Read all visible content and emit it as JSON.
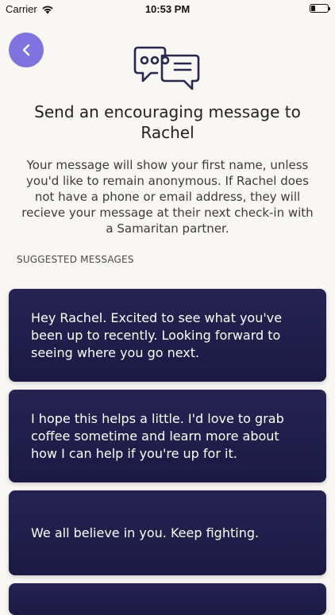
{
  "status_bar": {
    "carrier": "Carrier",
    "time": "10:53 PM",
    "battery_level_percent": 25
  },
  "header": {
    "back_icon": "chevron-left-icon",
    "back_button_color": "#8073df",
    "illustration_icon": "chat-bubbles-icon",
    "title": "Send an encouraging message to Rachel"
  },
  "description": "Your message will show your first name, unless you'd like to remain anonymous. If Rachel does not have a phone or email address, they will recieve your message at their next check-in with a Samaritan partner.",
  "suggested": {
    "label": "SUGGESTED MESSAGES",
    "card_color": "#221f4d",
    "messages": [
      "Hey Rachel. Excited to see what you've been up to recently. Looking forward to seeing where you go next.",
      "I hope this helps a little. I'd love to grab coffee sometime and learn more about how I can help if you're up for it.",
      "We all believe in you. Keep fighting.",
      ""
    ]
  }
}
